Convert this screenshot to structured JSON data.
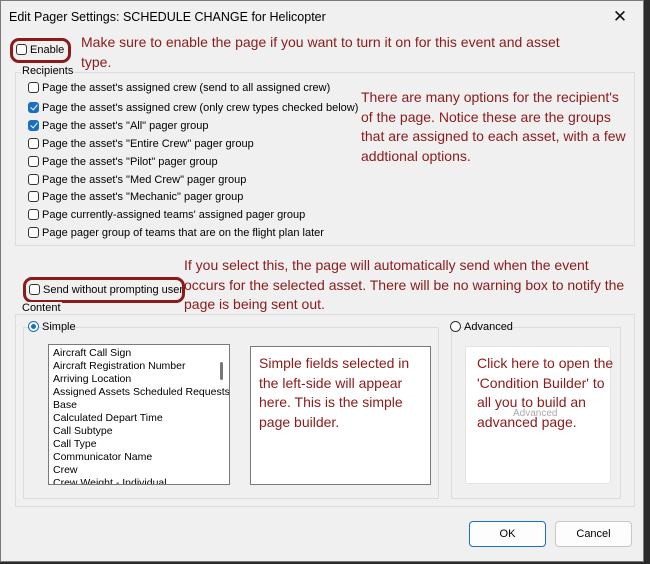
{
  "window": {
    "title": "Edit Pager Settings: SCHEDULE CHANGE for Helicopter",
    "close_glyph": "✕"
  },
  "enable": {
    "label": "Enable",
    "checked": false
  },
  "recipients": {
    "label": "Recipients",
    "options": [
      {
        "label": "Page the asset's assigned crew (send to all assigned crew)",
        "checked": false
      },
      {
        "label": "Page the asset's assigned crew (only crew types checked below)",
        "checked": true
      },
      {
        "label": "Page the asset's \"All\" pager group",
        "checked": true
      },
      {
        "label": "Page the asset's \"Entire Crew\" pager group",
        "checked": false
      },
      {
        "label": "Page the asset's \"Pilot\" pager group",
        "checked": false
      },
      {
        "label": "Page the asset's \"Med Crew\" pager group",
        "checked": false
      },
      {
        "label": "Page the asset's \"Mechanic\" pager group",
        "checked": false
      },
      {
        "label": "Page currently-assigned teams' assigned pager group",
        "checked": false
      },
      {
        "label": "Page pager group of teams that are on the flight plan later",
        "checked": false
      }
    ]
  },
  "send_without_prompting": {
    "label": "Send without prompting user",
    "checked": false
  },
  "content": {
    "label": "Content",
    "simple_label": "Simple",
    "advanced_label": "Advanced",
    "selected": "Simple",
    "fields": [
      "Aircraft Call Sign",
      "Aircraft Registration Number",
      "Arriving Location",
      "Assigned Assets Scheduled Requests",
      "Base",
      "Calculated Depart Time",
      "Call Subtype",
      "Call Type",
      "Communicator Name",
      "Crew",
      "Crew Weight - Individual"
    ],
    "advanced_placeholder": "Advanced"
  },
  "annotations": {
    "enable_note": "Make sure to enable the page if you want to turn it on for this event and asset type.",
    "recipients_note": "There are many options for the recipient's of the page. Notice these are the groups that are assigned to each asset, with a few addtional options.",
    "send_note": "If you select this, the page will automatically send when the event occurs for the selected asset. There will be no warning box to notify the page is being sent out.",
    "simple_note": "Simple fields selected in the left-side will appear here. This is the simple page builder.",
    "advanced_note": "Click here to open the 'Condition Builder' to all you to build an advanced page."
  },
  "buttons": {
    "ok": "OK",
    "cancel": "Cancel"
  },
  "colors": {
    "annotation": "#8b1a1a",
    "accent": "#1a6fc0"
  }
}
